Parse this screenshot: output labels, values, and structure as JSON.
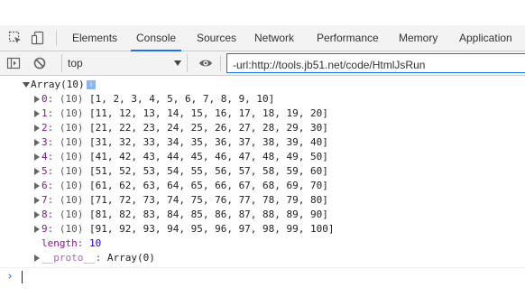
{
  "devtools": {
    "tabs": [
      {
        "label": "Elements"
      },
      {
        "label": "Console"
      },
      {
        "label": "Sources"
      },
      {
        "label": "Network"
      },
      {
        "label": "Performance"
      },
      {
        "label": "Memory"
      },
      {
        "label": "Application"
      }
    ],
    "active_tab": "Console",
    "accent_color": "#1a73e8"
  },
  "toolbar": {
    "context": "top",
    "filter_value": "-url:http://tools.jb51.net/code/HtmlJsRun"
  },
  "console": {
    "array_header": "Array(10)",
    "info_badge": "i",
    "rows": [
      {
        "key": "0",
        "len": "(10)",
        "values": "[1, 2, 3, 4, 5, 6, 7, 8, 9, 10]"
      },
      {
        "key": "1",
        "len": "(10)",
        "values": "[11, 12, 13, 14, 15, 16, 17, 18, 19, 20]"
      },
      {
        "key": "2",
        "len": "(10)",
        "values": "[21, 22, 23, 24, 25, 26, 27, 28, 29, 30]"
      },
      {
        "key": "3",
        "len": "(10)",
        "values": "[31, 32, 33, 34, 35, 36, 37, 38, 39, 40]"
      },
      {
        "key": "4",
        "len": "(10)",
        "values": "[41, 42, 43, 44, 45, 46, 47, 48, 49, 50]"
      },
      {
        "key": "5",
        "len": "(10)",
        "values": "[51, 52, 53, 54, 55, 56, 57, 58, 59, 60]"
      },
      {
        "key": "6",
        "len": "(10)",
        "values": "[61, 62, 63, 64, 65, 66, 67, 68, 69, 70]"
      },
      {
        "key": "7",
        "len": "(10)",
        "values": "[71, 72, 73, 74, 75, 76, 77, 78, 79, 80]"
      },
      {
        "key": "8",
        "len": "(10)",
        "values": "[81, 82, 83, 84, 85, 86, 87, 88, 89, 90]"
      },
      {
        "key": "9",
        "len": "(10)",
        "values": "[91, 92, 93, 94, 95, 96, 97, 98, 99, 100]"
      }
    ],
    "length_key": "length",
    "length_value": "10",
    "proto_key": "__proto__",
    "proto_value": "Array(0)",
    "prompt": "›"
  }
}
